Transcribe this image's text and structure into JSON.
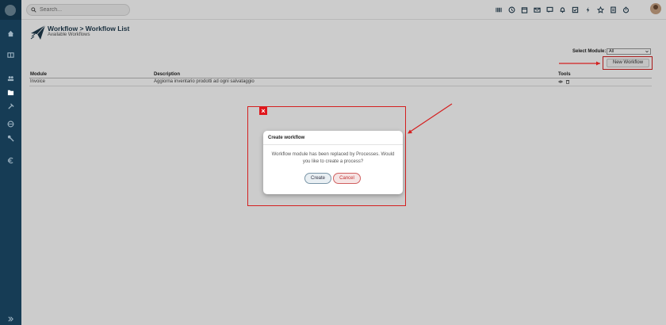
{
  "header": {
    "search_placeholder": "Search...",
    "icons": [
      "barcode-icon",
      "history-icon",
      "calendar-icon",
      "mail-icon",
      "chat-icon",
      "bell-icon",
      "checkbox-icon",
      "flash-icon",
      "star-icon",
      "document-icon",
      "timer-icon"
    ]
  },
  "sidebar": {
    "icons": [
      "home-icon",
      "grid-icon",
      "users-icon",
      "folder-icon",
      "tools-icon",
      "globe-icon",
      "wrench-icon",
      "euro-icon",
      "expand-icon"
    ]
  },
  "page": {
    "title": "Workflow > Workflow List",
    "subtitle": "Available Workflows",
    "select_module_label": "Select Module:",
    "select_module_value": "All",
    "new_workflow_label": "New Workflow"
  },
  "table": {
    "columns": [
      "Module",
      "Description",
      "Tools"
    ],
    "rows": [
      {
        "module": "Invoice",
        "description": "Aggiorna inventario prodotti ad ogni salvataggio"
      }
    ]
  },
  "modal": {
    "title": "Create workflow",
    "message": "Workflow module has been replaced by Processes. Would you like to create a process?",
    "create_label": "Create",
    "cancel_label": "Cancel",
    "close_symbol": "×"
  },
  "colors": {
    "sidebar": "#163c55",
    "highlight": "#d42020",
    "create_border": "#7a96a8",
    "cancel_border": "#d06060"
  }
}
